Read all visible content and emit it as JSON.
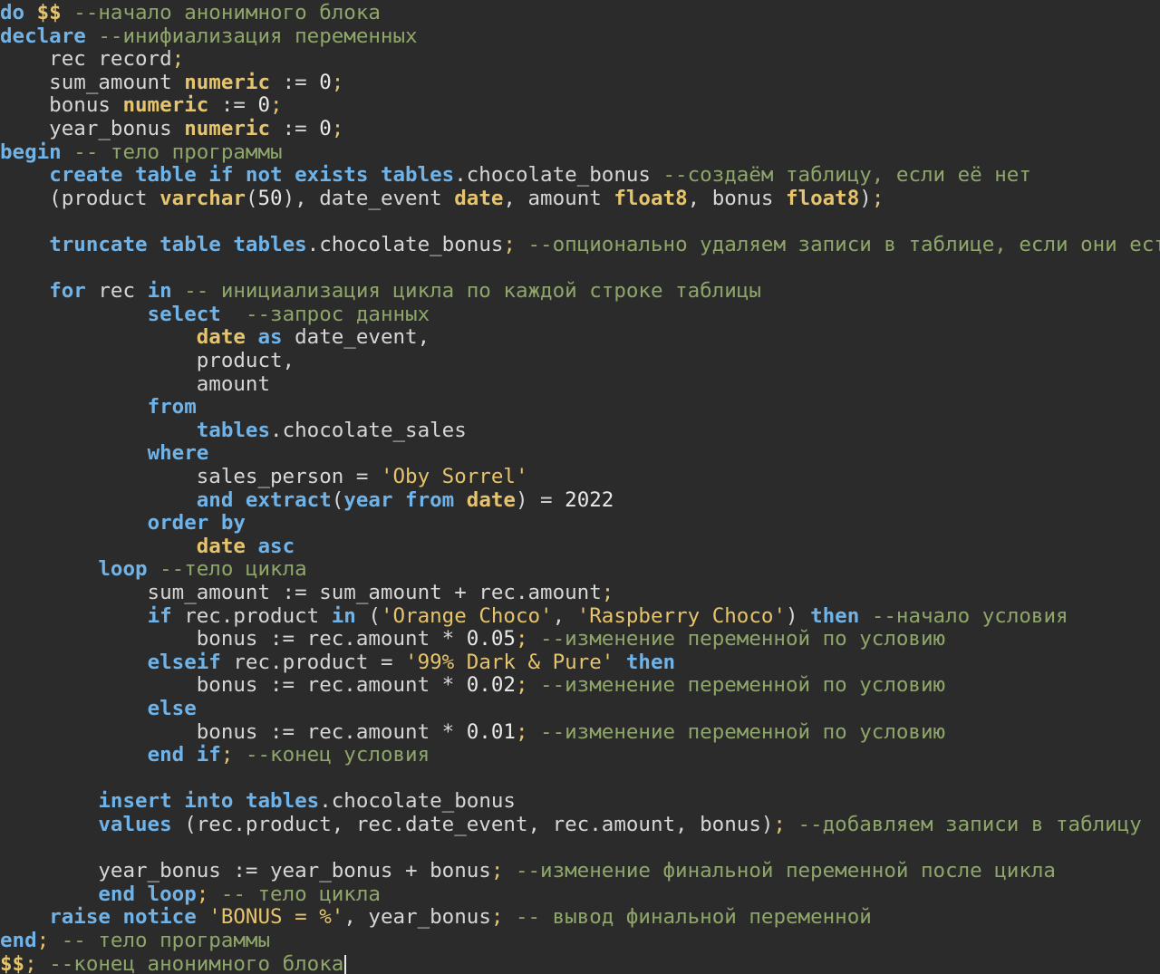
{
  "editor": {
    "language": "sql",
    "lines": [
      [
        [
          "kw",
          "do"
        ],
        [
          "id",
          " "
        ],
        [
          "dlr",
          "$$"
        ],
        [
          "id",
          " "
        ],
        [
          "cmt",
          "--начало анонимного блока"
        ]
      ],
      [
        [
          "kw",
          "declare"
        ],
        [
          "id",
          " "
        ],
        [
          "cmt",
          "--инифиализация переменных"
        ]
      ],
      [
        [
          "id",
          "    rec record"
        ],
        [
          "pun",
          ";"
        ]
      ],
      [
        [
          "id",
          "    sum_amount "
        ],
        [
          "typ",
          "numeric"
        ],
        [
          "id",
          " := "
        ],
        [
          "num",
          "0"
        ],
        [
          "pun",
          ";"
        ]
      ],
      [
        [
          "id",
          "    bonus "
        ],
        [
          "typ",
          "numeric"
        ],
        [
          "id",
          " := "
        ],
        [
          "num",
          "0"
        ],
        [
          "pun",
          ";"
        ]
      ],
      [
        [
          "id",
          "    year_bonus "
        ],
        [
          "typ",
          "numeric"
        ],
        [
          "id",
          " := "
        ],
        [
          "num",
          "0"
        ],
        [
          "pun",
          ";"
        ]
      ],
      [
        [
          "kw",
          "begin"
        ],
        [
          "id",
          " "
        ],
        [
          "cmt",
          "-- тело программы"
        ]
      ],
      [
        [
          "id",
          "    "
        ],
        [
          "kw",
          "create table if not exists"
        ],
        [
          "id",
          " "
        ],
        [
          "kw",
          "tables"
        ],
        [
          "id",
          ".chocolate_bonus "
        ],
        [
          "cmt",
          "--создаём таблицу, если её нет"
        ]
      ],
      [
        [
          "id",
          "    (product "
        ],
        [
          "typ",
          "varchar"
        ],
        [
          "id",
          "("
        ],
        [
          "num",
          "50"
        ],
        [
          "id",
          "), date_event "
        ],
        [
          "typ",
          "date"
        ],
        [
          "id",
          ", amount "
        ],
        [
          "typ",
          "float8"
        ],
        [
          "id",
          ", bonus "
        ],
        [
          "typ",
          "float8"
        ],
        [
          "id",
          ")"
        ],
        [
          "pun",
          ";"
        ]
      ],
      [],
      [
        [
          "id",
          "    "
        ],
        [
          "kw",
          "truncate table"
        ],
        [
          "id",
          " "
        ],
        [
          "kw",
          "tables"
        ],
        [
          "id",
          ".chocolate_bonus"
        ],
        [
          "pun",
          ";"
        ],
        [
          "id",
          " "
        ],
        [
          "cmt",
          "--опционально удаляем записи в таблице, если они есть"
        ]
      ],
      [],
      [
        [
          "id",
          "    "
        ],
        [
          "kw",
          "for"
        ],
        [
          "id",
          " rec "
        ],
        [
          "kw",
          "in"
        ],
        [
          "id",
          " "
        ],
        [
          "cmt",
          "-- инициализация цикла по каждой строке таблицы"
        ]
      ],
      [
        [
          "id",
          "            "
        ],
        [
          "kw",
          "select"
        ],
        [
          "id",
          "  "
        ],
        [
          "cmt",
          "--запрос данных"
        ]
      ],
      [
        [
          "id",
          "                "
        ],
        [
          "typ",
          "date"
        ],
        [
          "id",
          " "
        ],
        [
          "kw",
          "as"
        ],
        [
          "id",
          " date_event,"
        ]
      ],
      [
        [
          "id",
          "                product,"
        ]
      ],
      [
        [
          "id",
          "                amount"
        ]
      ],
      [
        [
          "id",
          "            "
        ],
        [
          "kw",
          "from"
        ]
      ],
      [
        [
          "id",
          "                "
        ],
        [
          "kw",
          "tables"
        ],
        [
          "id",
          ".chocolate_sales"
        ]
      ],
      [
        [
          "id",
          "            "
        ],
        [
          "kw",
          "where"
        ]
      ],
      [
        [
          "id",
          "                sales_person = "
        ],
        [
          "str",
          "'Oby Sorrel'"
        ]
      ],
      [
        [
          "id",
          "                "
        ],
        [
          "kw",
          "and extract"
        ],
        [
          "id",
          "("
        ],
        [
          "kw",
          "year from"
        ],
        [
          "id",
          " "
        ],
        [
          "typ",
          "date"
        ],
        [
          "id",
          ") = "
        ],
        [
          "num",
          "2022"
        ]
      ],
      [
        [
          "id",
          "            "
        ],
        [
          "kw",
          "order by"
        ]
      ],
      [
        [
          "id",
          "                "
        ],
        [
          "typ",
          "date"
        ],
        [
          "id",
          " "
        ],
        [
          "kw",
          "asc"
        ]
      ],
      [
        [
          "id",
          "        "
        ],
        [
          "kw",
          "loop"
        ],
        [
          "id",
          " "
        ],
        [
          "cmt",
          "--тело цикла"
        ]
      ],
      [
        [
          "id",
          "            sum_amount := sum_amount + rec.amount"
        ],
        [
          "pun",
          ";"
        ]
      ],
      [
        [
          "id",
          "            "
        ],
        [
          "kw",
          "if"
        ],
        [
          "id",
          " rec.product "
        ],
        [
          "kw",
          "in"
        ],
        [
          "id",
          " ("
        ],
        [
          "str",
          "'Orange Choco'"
        ],
        [
          "id",
          ", "
        ],
        [
          "str",
          "'Raspberry Choco'"
        ],
        [
          "id",
          ") "
        ],
        [
          "kw",
          "then"
        ],
        [
          "id",
          " "
        ],
        [
          "cmt",
          "--начало условия"
        ]
      ],
      [
        [
          "id",
          "                bonus := rec.amount * "
        ],
        [
          "num",
          "0.05"
        ],
        [
          "pun",
          ";"
        ],
        [
          "id",
          " "
        ],
        [
          "cmt",
          "--изменение переменной по условию"
        ]
      ],
      [
        [
          "id",
          "            "
        ],
        [
          "kw",
          "elseif"
        ],
        [
          "id",
          " rec.product = "
        ],
        [
          "str",
          "'99% Dark & Pure'"
        ],
        [
          "id",
          " "
        ],
        [
          "kw",
          "then"
        ]
      ],
      [
        [
          "id",
          "                bonus := rec.amount * "
        ],
        [
          "num",
          "0.02"
        ],
        [
          "pun",
          ";"
        ],
        [
          "id",
          " "
        ],
        [
          "cmt",
          "--изменение переменной по условию"
        ]
      ],
      [
        [
          "id",
          "            "
        ],
        [
          "kw",
          "else"
        ]
      ],
      [
        [
          "id",
          "                bonus := rec.amount * "
        ],
        [
          "num",
          "0.01"
        ],
        [
          "pun",
          ";"
        ],
        [
          "id",
          " "
        ],
        [
          "cmt",
          "--изменение переменной по условию"
        ]
      ],
      [
        [
          "id",
          "            "
        ],
        [
          "kw",
          "end if"
        ],
        [
          "pun",
          ";"
        ],
        [
          "id",
          " "
        ],
        [
          "cmt",
          "--конец условия"
        ]
      ],
      [],
      [
        [
          "id",
          "        "
        ],
        [
          "kw",
          "insert into"
        ],
        [
          "id",
          " "
        ],
        [
          "kw",
          "tables"
        ],
        [
          "id",
          ".chocolate_bonus"
        ]
      ],
      [
        [
          "id",
          "        "
        ],
        [
          "kw",
          "values"
        ],
        [
          "id",
          " (rec.product, rec.date_event, rec.amount, bonus)"
        ],
        [
          "pun",
          ";"
        ],
        [
          "id",
          " "
        ],
        [
          "cmt",
          "--добавляем записи в таблицу"
        ]
      ],
      [],
      [
        [
          "id",
          "        year_bonus := year_bonus + bonus"
        ],
        [
          "pun",
          ";"
        ],
        [
          "id",
          " "
        ],
        [
          "cmt",
          "--изменение финальной переменной после цикла"
        ]
      ],
      [
        [
          "id",
          "        "
        ],
        [
          "kw",
          "end loop"
        ],
        [
          "pun",
          ";"
        ],
        [
          "id",
          " "
        ],
        [
          "cmt",
          "-- тело цикла"
        ]
      ],
      [
        [
          "id",
          "    "
        ],
        [
          "kw",
          "raise notice"
        ],
        [
          "id",
          " "
        ],
        [
          "str",
          "'BONUS = %'"
        ],
        [
          "id",
          ", year_bonus"
        ],
        [
          "pun",
          ";"
        ],
        [
          "id",
          " "
        ],
        [
          "cmt",
          "-- вывод финальной переменной"
        ]
      ],
      [
        [
          "kw",
          "end"
        ],
        [
          "pun",
          ";"
        ],
        [
          "id",
          " "
        ],
        [
          "cmt",
          "-- тело программы"
        ]
      ],
      [
        [
          "dlr",
          "$$"
        ],
        [
          "pun",
          ";"
        ],
        [
          "id",
          " "
        ],
        [
          "cmt",
          "--конец анонимного блока"
        ]
      ]
    ]
  }
}
